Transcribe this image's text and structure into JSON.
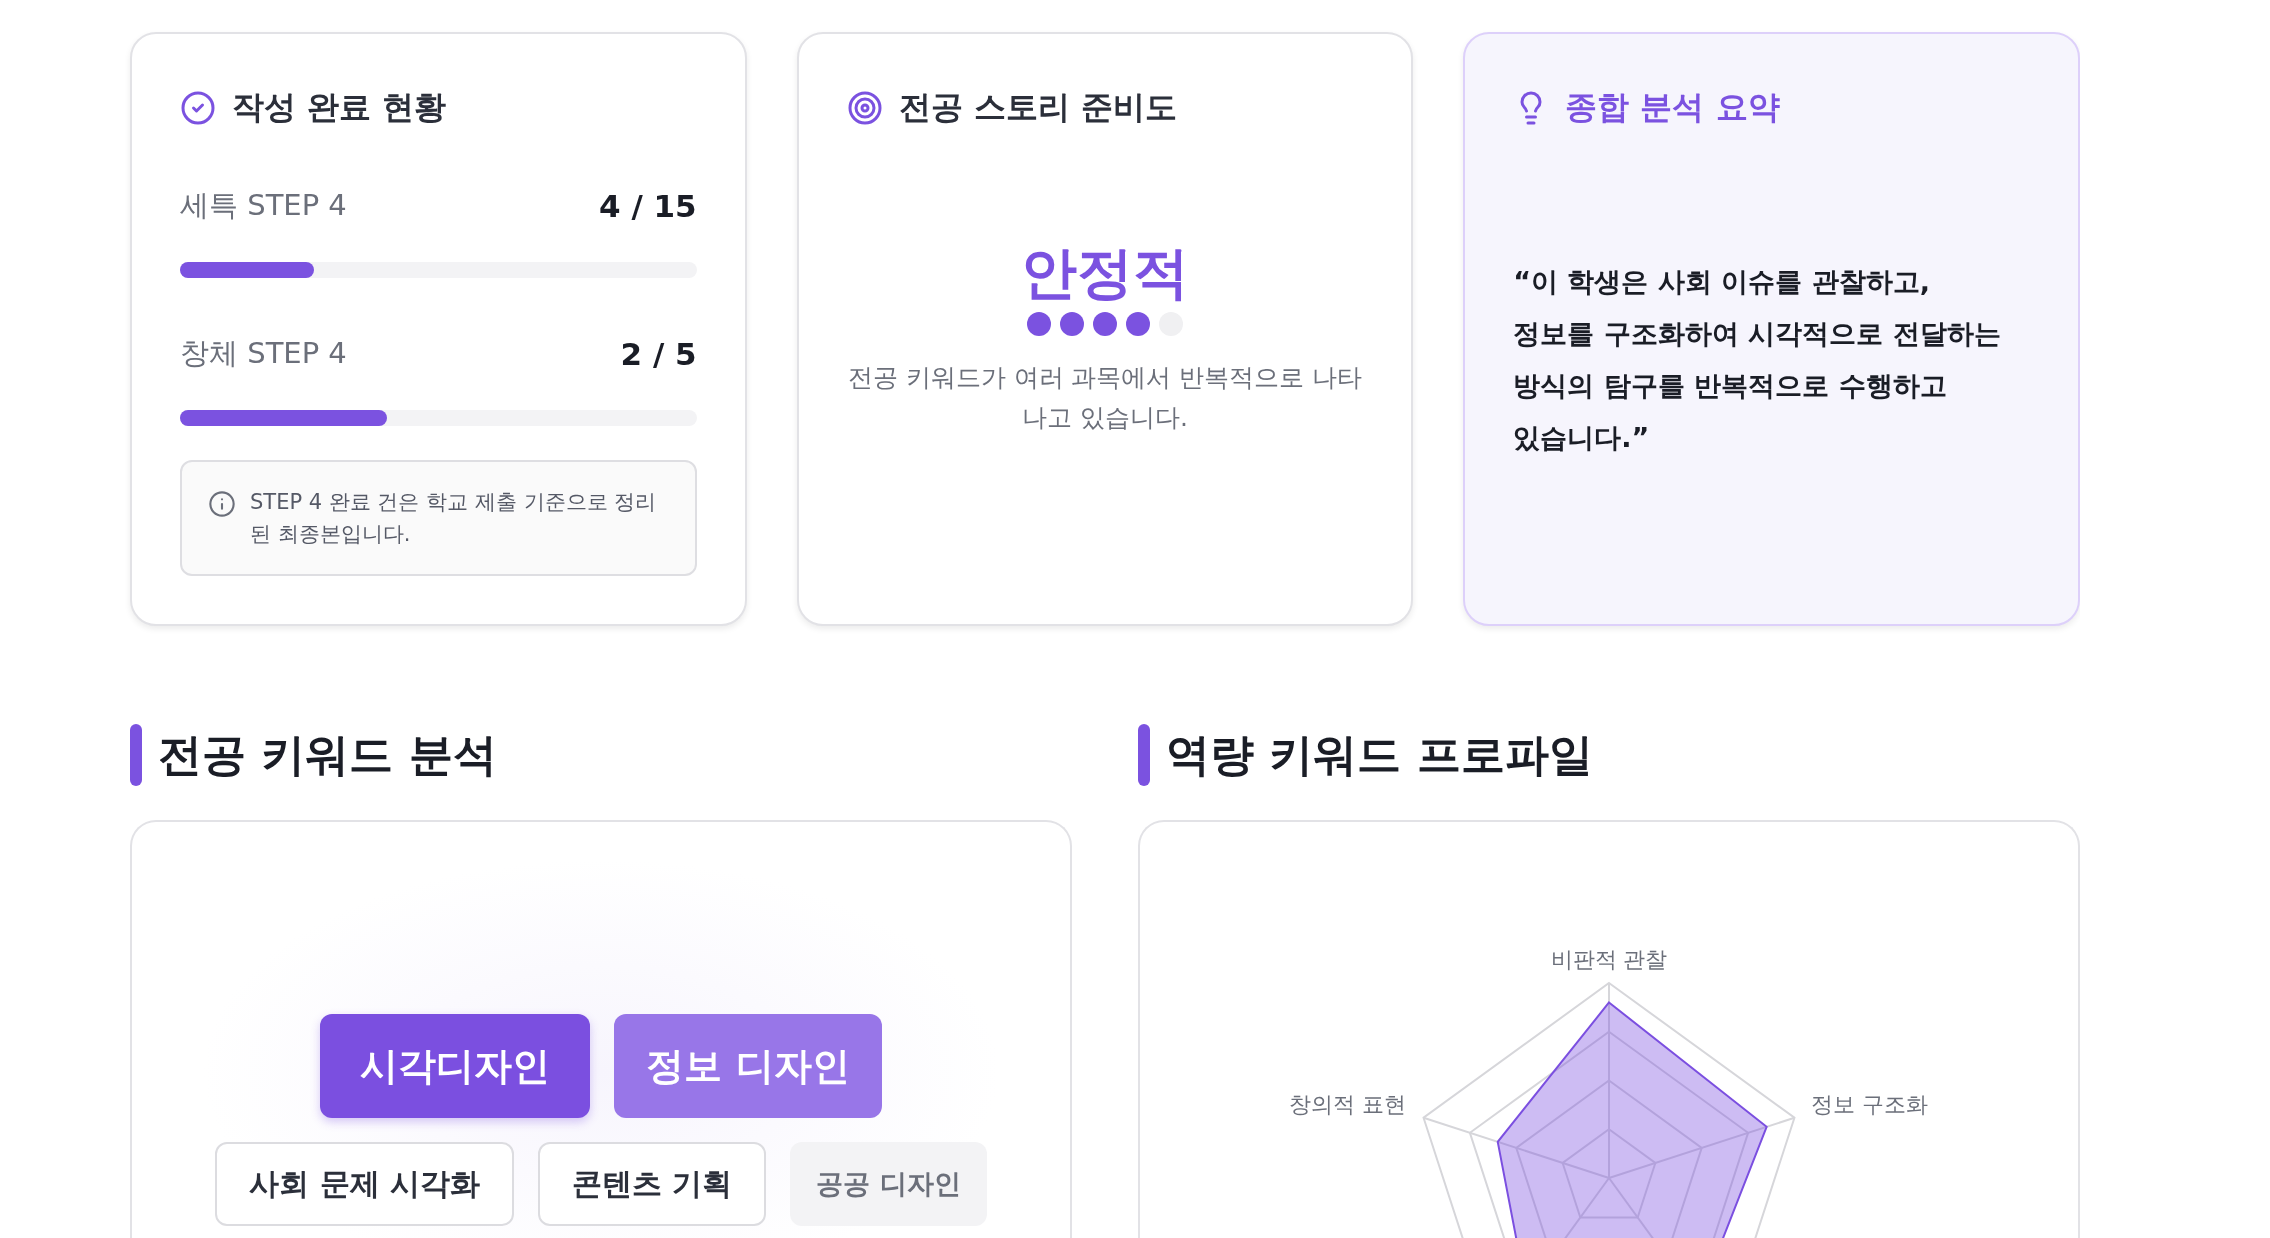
{
  "cards": [
    {
      "kind": "progress",
      "title": "작성 완료 현황",
      "items": [
        {
          "label": "세특 STEP 4",
          "count": "4 / 15",
          "level": 0.26
        },
        {
          "label": "창체 STEP 4",
          "count": "2 / 5",
          "level": 0.4
        }
      ],
      "note": "STEP 4 완료 건은 학교 제출 기준으로 정리된 최종본입니다."
    },
    {
      "kind": "readiness",
      "title": "전공 스토리 준비도",
      "status": "안정적",
      "dots": [
        {
          "filled": true
        },
        {
          "filled": true
        },
        {
          "filled": true
        },
        {
          "filled": true
        },
        {
          "filled": false
        }
      ],
      "description": "전공 키워드가 여러 과목에서 반복적으로 나타나고 있습니다."
    },
    {
      "kind": "summary",
      "title": "종합 분석 요약",
      "quote": "“이 학생은 사회 이슈를 관찰하고, 정보를 구조화하여 시각적으로 전달하는 방식의 탐구를 반복적으로 수행하고 있습니다.”"
    }
  ],
  "sections": [
    {
      "kind": "keywords",
      "heading": "전공 키워드 분석",
      "keywords": [
        {
          "label": "시각디자인",
          "kind": "primary"
        },
        {
          "label": "정보 디자인",
          "kind": "secondary"
        },
        {
          "label": "사회 문제 시각화",
          "kind": "outline"
        },
        {
          "label": "콘텐츠 기획",
          "kind": "outline"
        },
        {
          "label": "공공 디자인",
          "kind": "muted"
        }
      ]
    },
    {
      "kind": "radar",
      "heading": "역량 키워드 프로파일",
      "axes": [
        {
          "label": "비판적 관찰"
        },
        {
          "label": "정보 구조화"
        },
        {
          "label": "창의적 표현"
        }
      ]
    }
  ]
}
